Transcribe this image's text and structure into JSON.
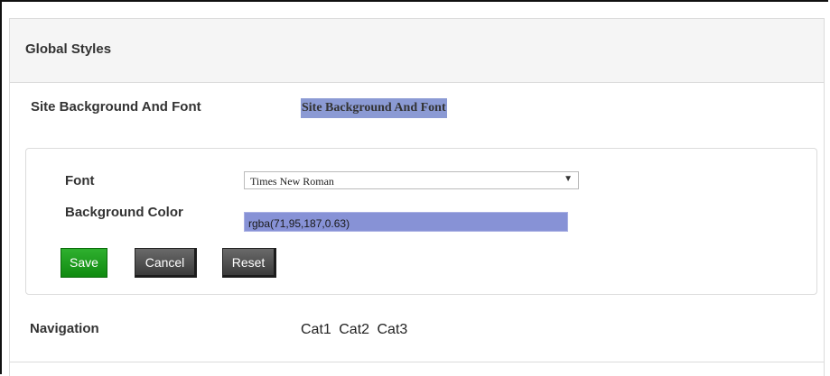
{
  "panel": {
    "title": "Global Styles"
  },
  "site_background": {
    "label": "Site Background And Font",
    "preview_text": "Site Background And Font",
    "preview_bg_color": "rgba(71,95,187,0.63)"
  },
  "form": {
    "font_label": "Font",
    "font_value": "Times New Roman",
    "background_color_label": "Background Color",
    "background_color_value": "rgba(71,95,187,0.63)",
    "save_label": "Save",
    "cancel_label": "Cancel",
    "reset_label": "Reset"
  },
  "navigation": {
    "label": "Navigation",
    "items": [
      "Cat1",
      "Cat2",
      "Cat3"
    ]
  },
  "colors": {
    "save_button": "#1f9e1f",
    "dark_button": "#4a4a4a",
    "header_bg": "#f5f5f5"
  },
  "icons": {
    "select_arrow": "chevron-down-icon"
  }
}
